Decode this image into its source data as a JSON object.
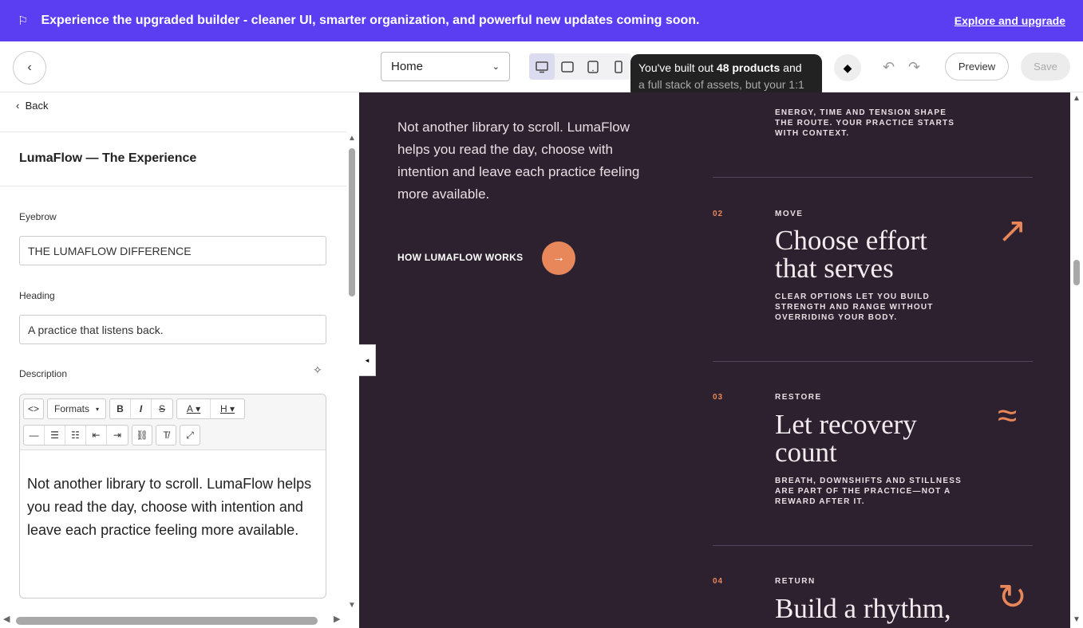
{
  "banner": {
    "flag_icon": "flag-icon",
    "message": "Experience the upgraded builder - cleaner UI, smarter organization, and powerful new updates coming soon.",
    "link": "Explore and upgrade"
  },
  "toolbar": {
    "page_select": "Home",
    "tooltip_bold": "48 products",
    "tooltip_pre": "You've built out ",
    "tooltip_post": " and",
    "tooltip_line2": "a full stack of assets, but your 1:1",
    "preview": "Preview",
    "save": "Save"
  },
  "left": {
    "back": "Back",
    "section_title": "LumaFlow — The Experience",
    "eyebrow_label": "Eyebrow",
    "eyebrow_value": "THE LUMAFLOW DIFFERENCE",
    "heading_label": "Heading",
    "heading_value": "A practice that listens back.",
    "description_label": "Description",
    "formats": "Formats",
    "description_text": "Not another library to scroll. LumaFlow helps you read the day, choose with intention and leave each practice feeling more available."
  },
  "canvas": {
    "intro": "Not another library to scroll. LumaFlow helps you read the day, choose with intention and leave each practice feeling more available.",
    "how_works": "HOW LUMAFLOW WORKS",
    "arrow": "→",
    "step1_desc": "ENERGY, TIME AND TENSION SHAPE THE ROUTE. YOUR PRACTICE STARTS WITH CONTEXT.",
    "steps": [
      {
        "num": "02",
        "label": "MOVE",
        "heading": "Choose effort that serves",
        "desc": "CLEAR OPTIONS LET YOU BUILD STRENGTH AND RANGE WITHOUT OVERRIDING YOUR BODY.",
        "icon": "↗"
      },
      {
        "num": "03",
        "label": "RESTORE",
        "heading": "Let recovery count",
        "desc": "BREATH, DOWNSHIFTS AND STILLNESS ARE PART OF THE PRACTICE—NOT A REWARD AFTER IT.",
        "icon": "≈"
      },
      {
        "num": "04",
        "label": "RETURN",
        "heading": "Build a rhythm,",
        "desc": "",
        "icon": "↻"
      }
    ]
  }
}
